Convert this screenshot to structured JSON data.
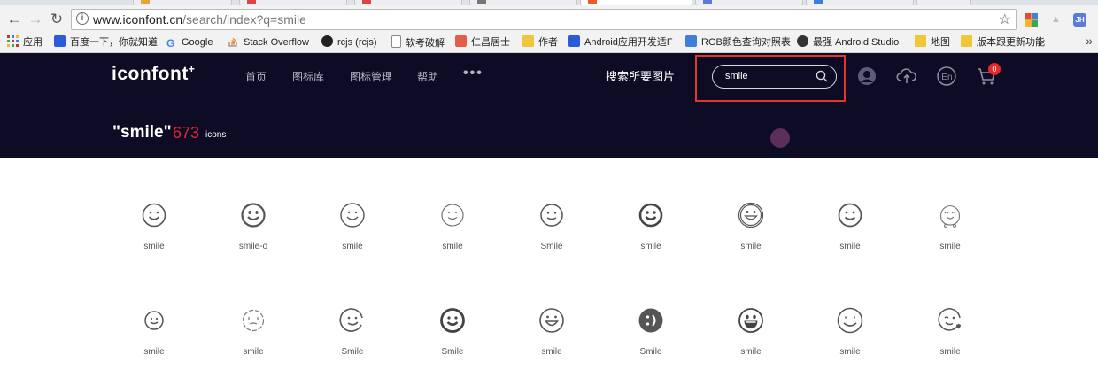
{
  "browser": {
    "url_host": "www.iconfont.cn",
    "url_path": "/search/index?q=smile",
    "extensions": [
      {
        "name": "jsonview-ext-icon",
        "color": "#e8a33a",
        "label": ""
      },
      {
        "name": "drive-ext-icon",
        "color": "#bdbdbd",
        "label": "▲"
      },
      {
        "name": "profile-jh-icon",
        "color": "#5b7bd5",
        "label": "JH"
      }
    ]
  },
  "bookmarks": [
    {
      "label": "应用",
      "icon": "apps-grid-icon",
      "color": "#c0392b"
    },
    {
      "label": "百度一下，你就知道",
      "icon": "baidu-paw-icon",
      "color": "#2b5bd7"
    },
    {
      "label": "Google",
      "icon": "google-g-icon",
      "color": "#4285f4"
    },
    {
      "label": "Stack Overflow",
      "icon": "stackoverflow-icon",
      "color": "#f48024"
    },
    {
      "label": "rcjs (rcjs)",
      "icon": "github-icon",
      "color": "#222222"
    },
    {
      "label": "软考破解",
      "icon": "document-icon",
      "color": "#888888"
    },
    {
      "label": "仁昌居士",
      "icon": "csdn-icon",
      "color": "#e45d4b"
    },
    {
      "label": "作者",
      "icon": "folder-icon",
      "color": "#f0c73b"
    },
    {
      "label": "Android应用开发适F",
      "icon": "baidu-paw-icon",
      "color": "#2b5bd7"
    },
    {
      "label": "RGB颜色查询对照表",
      "icon": "rgb-icon",
      "color": "#3f7fd8"
    },
    {
      "label": "最强 Android Studio",
      "icon": "fire-icon",
      "color": "#333333"
    },
    {
      "label": "地图",
      "icon": "folder-icon",
      "color": "#f0c73b"
    },
    {
      "label": "版本跟更新功能",
      "icon": "folder-icon",
      "color": "#f0c73b"
    }
  ],
  "header": {
    "logo": "iconfont",
    "logo_mark": "+",
    "nav": [
      "首页",
      "图标库",
      "图标管理",
      "帮助"
    ],
    "more": "•••",
    "search_by_image": "搜索所要图片",
    "search_value": "smile",
    "cart_count": "0",
    "result_query": "\"smile\"",
    "result_count": "673",
    "result_unit": "icons"
  },
  "icons_row1": [
    {
      "label": "smile",
      "icon": "smile-thin-icon"
    },
    {
      "label": "smile-o",
      "icon": "smile-o-icon"
    },
    {
      "label": "smile",
      "icon": "smile-round-icon"
    },
    {
      "label": "smile",
      "icon": "smile-light-icon"
    },
    {
      "label": "Smile",
      "icon": "smile-small-icon"
    },
    {
      "label": "smile",
      "icon": "smile-bold-icon"
    },
    {
      "label": "smile",
      "icon": "smile-double-ring-icon"
    },
    {
      "label": "smile",
      "icon": "smile-plain-icon"
    },
    {
      "label": "smile",
      "icon": "smile-cute-icon"
    }
  ],
  "icons_row2": [
    {
      "label": "smile",
      "icon": "smile-mini-icon"
    },
    {
      "label": "smile",
      "icon": "smile-dashed-icon"
    },
    {
      "label": "Smile",
      "icon": "smile-tilted-icon"
    },
    {
      "label": "Smile",
      "icon": "smile-thick-icon"
    },
    {
      "label": "smile",
      "icon": "smile-grin-icon"
    },
    {
      "label": "Smile",
      "icon": "smile-filled-icon"
    },
    {
      "label": "smile",
      "icon": "smile-laugh-icon"
    },
    {
      "label": "smile",
      "icon": "smile-wide-icon"
    },
    {
      "label": "smile",
      "icon": "smile-heart-wink-icon"
    }
  ]
}
